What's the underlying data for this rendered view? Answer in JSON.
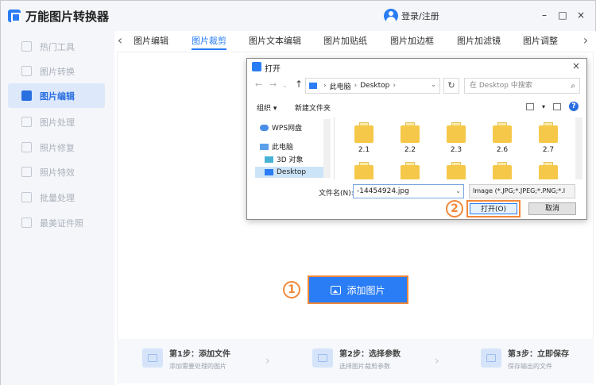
{
  "app": {
    "title": "万能图片转换器",
    "login": "登录/注册",
    "minimize": "–",
    "maximize": "□",
    "close": "×"
  },
  "sidebar": {
    "items": [
      {
        "label": "热门工具"
      },
      {
        "label": "图片转换"
      },
      {
        "label": "图片编辑"
      },
      {
        "label": "图片处理"
      },
      {
        "label": "照片修复"
      },
      {
        "label": "照片特效"
      },
      {
        "label": "批量处理"
      },
      {
        "label": "最美证件照"
      }
    ],
    "active_index": 2
  },
  "tabs": {
    "items": [
      {
        "label": "图片编辑"
      },
      {
        "label": "图片裁剪"
      },
      {
        "label": "图片文本编辑"
      },
      {
        "label": "图片加贴纸"
      },
      {
        "label": "图片加边框"
      },
      {
        "label": "图片加滤镜"
      },
      {
        "label": "图片调整"
      }
    ],
    "active_index": 1,
    "prev": "‹",
    "next": "›"
  },
  "main": {
    "add_button": "添加图片",
    "marker_1": "1",
    "marker_2": "2"
  },
  "steps": [
    {
      "title": "第1步：添加文件",
      "desc": "添加需要处理的图片"
    },
    {
      "title": "第2步：选择参数",
      "desc": "选择图片裁剪参数"
    },
    {
      "title": "第3步：立即保存",
      "desc": "保存输出的文件"
    }
  ],
  "dialog": {
    "title": "打开",
    "close": "×",
    "address": {
      "root": "此电脑",
      "folder": "Desktop"
    },
    "search_placeholder": "在 Desktop 中搜索",
    "organize": "组织 ▾",
    "new_folder": "新建文件夹",
    "help": "?",
    "nav": [
      {
        "label": "WPS网盘"
      },
      {
        "label": "此电脑"
      },
      {
        "label": "3D 对象"
      },
      {
        "label": "Desktop"
      }
    ],
    "folders": [
      "2.1",
      "2.2",
      "2.3",
      "2.6",
      "2.7"
    ],
    "filename_label": "文件名(N):",
    "filename_value": "-14454924.jpg",
    "filetype": "Image (*.JPG;*.JPEG;*.PNG;*.I",
    "open_button": "打开(O)",
    "cancel_button": "取消"
  },
  "colors": {
    "accent": "#2a7df4",
    "highlight": "#f2883a"
  }
}
